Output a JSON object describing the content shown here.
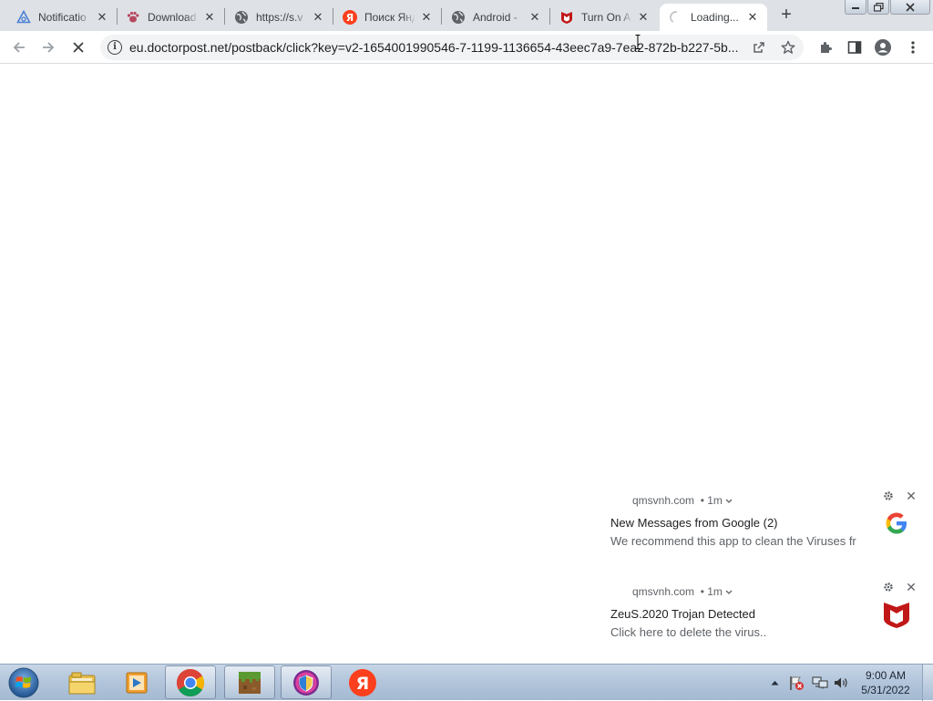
{
  "browser": {
    "tabs": [
      {
        "title": "Notificatio",
        "icon": "bell-triangle-icon"
      },
      {
        "title": "Download",
        "icon": "download-paw-icon"
      },
      {
        "title": "https://s.v",
        "icon": "globe-icon"
      },
      {
        "title": "Поиск Янд",
        "icon": "yandex-icon"
      },
      {
        "title": "Android -",
        "icon": "globe-icon"
      },
      {
        "title": "Turn On A",
        "icon": "mcafee-icon"
      },
      {
        "title": "Loading...",
        "icon": "spinner-icon",
        "active": true
      }
    ],
    "new_tab": "+",
    "url": "eu.doctorpost.net/postback/click?key=v2-1654001990546-7-1199-1136654-43eec7a9-7ea2-872b-b227-5b..."
  },
  "notifications": [
    {
      "origin": "qmsvnh.com",
      "time": "1m",
      "title": "New Messages from Google (2)",
      "body": "We recommend this app to clean the Viruses fr",
      "icon": "google-icon"
    },
    {
      "origin": "qmsvnh.com",
      "time": "1m",
      "title": "ZeuS.2020 Trojan Detected",
      "body": "Click here to delete the virus..",
      "icon": "mcafee-shield-icon"
    }
  ],
  "taskbar": {
    "apps": [
      "file-explorer-icon",
      "media-player-icon",
      "chrome-icon",
      "minecraft-icon",
      "installer-icon",
      "yandex-browser-icon"
    ],
    "clock_time": "9:00 AM",
    "clock_date": "5/31/2022"
  },
  "colors": {
    "tabstrip": "#dee1e6",
    "mcafee_red": "#c01818",
    "yandex_red": "#fc3f1d"
  }
}
